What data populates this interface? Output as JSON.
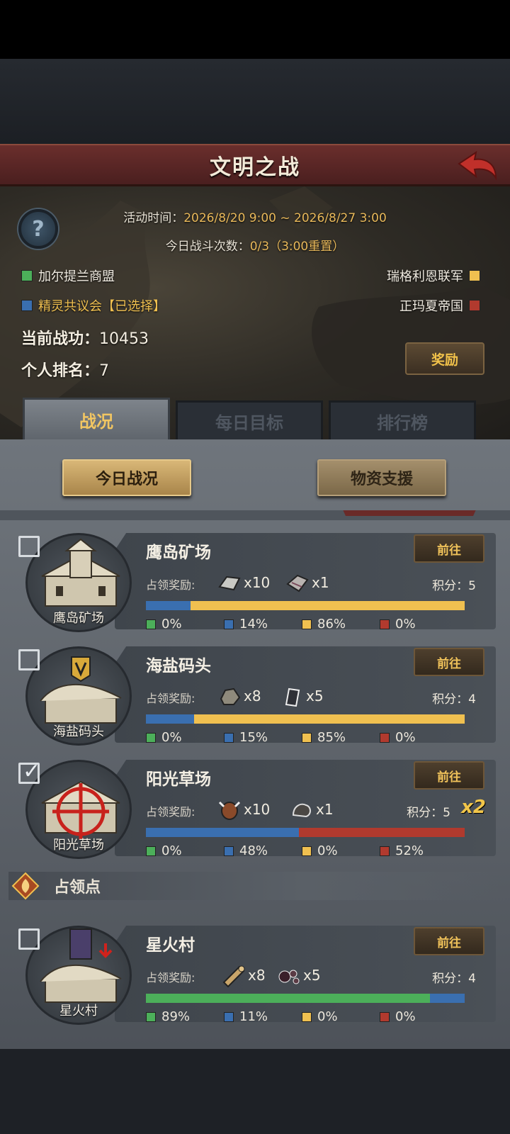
{
  "header": {
    "title": "文明之战"
  },
  "event": {
    "time_label": "活动时间：",
    "time_value": "2026/8/20 9:00 ~ 2026/8/27 3:00",
    "battles_label": "今日战斗次数：",
    "battles_value": "0/3（3:00重置）"
  },
  "factions": [
    {
      "name": "加尔提兰商盟",
      "color": "#4caf5a"
    },
    {
      "name": "精灵共议会【已选择】",
      "color": "#3a6fb0"
    },
    {
      "name": "瑞格利恩联军",
      "color": "#f0c050"
    },
    {
      "name": "正玛夏帝国",
      "color": "#b13a2e"
    }
  ],
  "stats": {
    "merit_label": "当前战功：",
    "merit_value": "10453",
    "rank_label": "个人排名：",
    "rank_value": "7"
  },
  "reward_button": "奖励",
  "tabs": [
    "战况",
    "每日目标",
    "排行榜"
  ],
  "sub_buttons": [
    "今日战况",
    "物资支援"
  ],
  "section_title": "占领点",
  "goto_label": "前往",
  "reward_label": "占领奖励:",
  "score_label": "积分：",
  "points": [
    {
      "name": "鹰岛矿场",
      "badge_label": "鹰岛矿场",
      "checked": false,
      "multiplier": "",
      "score": "5",
      "rewards": [
        {
          "icon": "silver-ingot-icon",
          "qty": "x10"
        },
        {
          "icon": "crate-icon",
          "qty": "x1"
        }
      ],
      "shares": [
        0,
        14,
        86,
        0
      ],
      "share_labels": [
        "0%",
        "14%",
        "86%",
        "0%"
      ]
    },
    {
      "name": "海盐码头",
      "badge_label": "海盐码头",
      "checked": false,
      "multiplier": "",
      "score": "4",
      "rewards": [
        {
          "icon": "stone-ore-icon",
          "qty": "x8"
        },
        {
          "icon": "iron-ingot-icon",
          "qty": "x5"
        }
      ],
      "shares": [
        0,
        15,
        85,
        0
      ],
      "share_labels": [
        "0%",
        "15%",
        "85%",
        "0%"
      ]
    },
    {
      "name": "阳光草场",
      "badge_label": "阳光草场",
      "checked": true,
      "multiplier": "x2",
      "score": "5",
      "rewards": [
        {
          "icon": "ox-icon",
          "qty": "x10"
        },
        {
          "icon": "coal-icon",
          "qty": "x1"
        }
      ],
      "shares": [
        0,
        48,
        0,
        52
      ],
      "share_labels": [
        "0%",
        "48%",
        "0%",
        "52%"
      ]
    },
    {
      "name": "星火村",
      "badge_label": "星火村",
      "checked": false,
      "multiplier": "",
      "score": "4",
      "rewards": [
        {
          "icon": "wood-log-icon",
          "qty": "x8"
        },
        {
          "icon": "pearls-icon",
          "qty": "x5"
        }
      ],
      "shares": [
        89,
        11,
        0,
        0
      ],
      "share_labels": [
        "89%",
        "11%",
        "0%",
        "0%"
      ]
    }
  ]
}
